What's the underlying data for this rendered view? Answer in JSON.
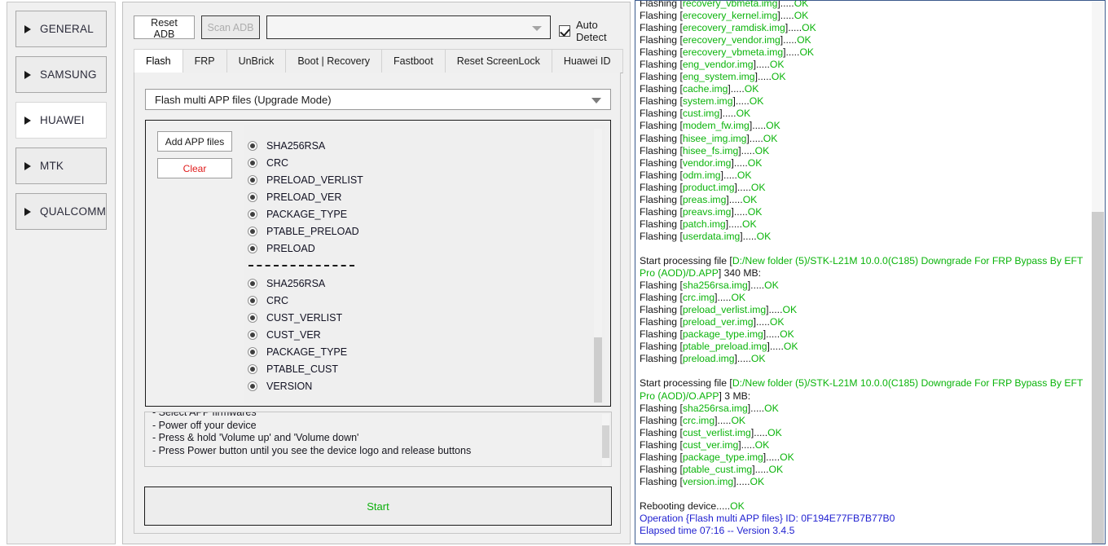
{
  "sidebar": {
    "items": [
      {
        "label": "GENERAL",
        "active": false
      },
      {
        "label": "SAMSUNG",
        "active": false
      },
      {
        "label": "HUAWEI",
        "active": true
      },
      {
        "label": "MTK",
        "active": false
      },
      {
        "label": "QUALCOMM",
        "active": false
      }
    ]
  },
  "toolbar": {
    "reset_adb_label": "Reset ADB",
    "scan_adb_label": "Scan ADB",
    "device_combo_value": "",
    "auto_detect_label": "Auto Detect",
    "auto_detect_checked": true
  },
  "tabs": [
    {
      "label": "Flash",
      "active": true
    },
    {
      "label": "FRP",
      "active": false
    },
    {
      "label": "UnBrick",
      "active": false
    },
    {
      "label": "Boot | Recovery",
      "active": false
    },
    {
      "label": "Fastboot",
      "active": false
    },
    {
      "label": "Reset ScreenLock",
      "active": false
    },
    {
      "label": "Huawei ID",
      "active": false
    }
  ],
  "flash": {
    "mode_value": "Flash multi APP files (Upgrade Mode)",
    "add_app_label": "Add APP files",
    "clear_label": "Clear",
    "start_label": "Start",
    "partitions": [
      "SHA256RSA",
      "CRC",
      "PRELOAD_VERLIST",
      "PRELOAD_VER",
      "PACKAGE_TYPE",
      "PTABLE_PRELOAD",
      "PRELOAD",
      "---SEPARATOR---",
      "SHA256RSA",
      "CRC",
      "CUST_VERLIST",
      "CUST_VER",
      "PACKAGE_TYPE",
      "PTABLE_CUST",
      "VERSION"
    ],
    "instructions": [
      "- Select APP firmwares",
      "- Power off your device",
      "- Press & hold 'Volume up' and 'Volume down'",
      "- Press Power button until you see the device logo and release buttons"
    ]
  },
  "log": {
    "lines": [
      {
        "segments": [
          {
            "t": "Flashing [",
            "c": "k"
          },
          {
            "t": "recovery_vbmeta.img",
            "c": "g"
          },
          {
            "t": "].....",
            "c": "k"
          },
          {
            "t": "OK",
            "c": "g"
          }
        ]
      },
      {
        "segments": [
          {
            "t": "Flashing [",
            "c": "k"
          },
          {
            "t": "erecovery_kernel.img",
            "c": "g"
          },
          {
            "t": "].....",
            "c": "k"
          },
          {
            "t": "OK",
            "c": "g"
          }
        ]
      },
      {
        "segments": [
          {
            "t": "Flashing [",
            "c": "k"
          },
          {
            "t": "erecovery_ramdisk.img",
            "c": "g"
          },
          {
            "t": "].....",
            "c": "k"
          },
          {
            "t": "OK",
            "c": "g"
          }
        ]
      },
      {
        "segments": [
          {
            "t": "Flashing [",
            "c": "k"
          },
          {
            "t": "erecovery_vendor.img",
            "c": "g"
          },
          {
            "t": "].....",
            "c": "k"
          },
          {
            "t": "OK",
            "c": "g"
          }
        ]
      },
      {
        "segments": [
          {
            "t": "Flashing [",
            "c": "k"
          },
          {
            "t": "erecovery_vbmeta.img",
            "c": "g"
          },
          {
            "t": "].....",
            "c": "k"
          },
          {
            "t": "OK",
            "c": "g"
          }
        ]
      },
      {
        "segments": [
          {
            "t": "Flashing [",
            "c": "k"
          },
          {
            "t": "eng_vendor.img",
            "c": "g"
          },
          {
            "t": "].....",
            "c": "k"
          },
          {
            "t": "OK",
            "c": "g"
          }
        ]
      },
      {
        "segments": [
          {
            "t": "Flashing [",
            "c": "k"
          },
          {
            "t": "eng_system.img",
            "c": "g"
          },
          {
            "t": "].....",
            "c": "k"
          },
          {
            "t": "OK",
            "c": "g"
          }
        ]
      },
      {
        "segments": [
          {
            "t": "Flashing [",
            "c": "k"
          },
          {
            "t": "cache.img",
            "c": "g"
          },
          {
            "t": "].....",
            "c": "k"
          },
          {
            "t": "OK",
            "c": "g"
          }
        ]
      },
      {
        "segments": [
          {
            "t": "Flashing [",
            "c": "k"
          },
          {
            "t": "system.img",
            "c": "g"
          },
          {
            "t": "].....",
            "c": "k"
          },
          {
            "t": "OK",
            "c": "g"
          }
        ]
      },
      {
        "segments": [
          {
            "t": "Flashing [",
            "c": "k"
          },
          {
            "t": "cust.img",
            "c": "g"
          },
          {
            "t": "].....",
            "c": "k"
          },
          {
            "t": "OK",
            "c": "g"
          }
        ]
      },
      {
        "segments": [
          {
            "t": "Flashing [",
            "c": "k"
          },
          {
            "t": "modem_fw.img",
            "c": "g"
          },
          {
            "t": "].....",
            "c": "k"
          },
          {
            "t": "OK",
            "c": "g"
          }
        ]
      },
      {
        "segments": [
          {
            "t": "Flashing [",
            "c": "k"
          },
          {
            "t": "hisee_img.img",
            "c": "g"
          },
          {
            "t": "].....",
            "c": "k"
          },
          {
            "t": "OK",
            "c": "g"
          }
        ]
      },
      {
        "segments": [
          {
            "t": "Flashing [",
            "c": "k"
          },
          {
            "t": "hisee_fs.img",
            "c": "g"
          },
          {
            "t": "].....",
            "c": "k"
          },
          {
            "t": "OK",
            "c": "g"
          }
        ]
      },
      {
        "segments": [
          {
            "t": "Flashing [",
            "c": "k"
          },
          {
            "t": "vendor.img",
            "c": "g"
          },
          {
            "t": "].....",
            "c": "k"
          },
          {
            "t": "OK",
            "c": "g"
          }
        ]
      },
      {
        "segments": [
          {
            "t": "Flashing [",
            "c": "k"
          },
          {
            "t": "odm.img",
            "c": "g"
          },
          {
            "t": "].....",
            "c": "k"
          },
          {
            "t": "OK",
            "c": "g"
          }
        ]
      },
      {
        "segments": [
          {
            "t": "Flashing [",
            "c": "k"
          },
          {
            "t": "product.img",
            "c": "g"
          },
          {
            "t": "].....",
            "c": "k"
          },
          {
            "t": "OK",
            "c": "g"
          }
        ]
      },
      {
        "segments": [
          {
            "t": "Flashing [",
            "c": "k"
          },
          {
            "t": "preas.img",
            "c": "g"
          },
          {
            "t": "].....",
            "c": "k"
          },
          {
            "t": "OK",
            "c": "g"
          }
        ]
      },
      {
        "segments": [
          {
            "t": "Flashing [",
            "c": "k"
          },
          {
            "t": "preavs.img",
            "c": "g"
          },
          {
            "t": "].....",
            "c": "k"
          },
          {
            "t": "OK",
            "c": "g"
          }
        ]
      },
      {
        "segments": [
          {
            "t": "Flashing [",
            "c": "k"
          },
          {
            "t": "patch.img",
            "c": "g"
          },
          {
            "t": "].....",
            "c": "k"
          },
          {
            "t": "OK",
            "c": "g"
          }
        ]
      },
      {
        "segments": [
          {
            "t": "Flashing [",
            "c": "k"
          },
          {
            "t": "userdata.img",
            "c": "g"
          },
          {
            "t": "].....",
            "c": "k"
          },
          {
            "t": "OK",
            "c": "g"
          }
        ]
      },
      {
        "segments": [
          {
            "t": "",
            "c": "k"
          }
        ]
      },
      {
        "segments": [
          {
            "t": "Start processing file [",
            "c": "k"
          },
          {
            "t": "D:/New folder (5)/STK-L21M 10.0.0(C185) Downgrade For FRP Bypass By EFT Pro (AOD)/D.APP",
            "c": "g"
          },
          {
            "t": "] 340 MB:",
            "c": "k"
          }
        ]
      },
      {
        "segments": [
          {
            "t": "Flashing [",
            "c": "k"
          },
          {
            "t": "sha256rsa.img",
            "c": "g"
          },
          {
            "t": "].....",
            "c": "k"
          },
          {
            "t": "OK",
            "c": "g"
          }
        ]
      },
      {
        "segments": [
          {
            "t": "Flashing [",
            "c": "k"
          },
          {
            "t": "crc.img",
            "c": "g"
          },
          {
            "t": "].....",
            "c": "k"
          },
          {
            "t": "OK",
            "c": "g"
          }
        ]
      },
      {
        "segments": [
          {
            "t": "Flashing [",
            "c": "k"
          },
          {
            "t": "preload_verlist.img",
            "c": "g"
          },
          {
            "t": "].....",
            "c": "k"
          },
          {
            "t": "OK",
            "c": "g"
          }
        ]
      },
      {
        "segments": [
          {
            "t": "Flashing [",
            "c": "k"
          },
          {
            "t": "preload_ver.img",
            "c": "g"
          },
          {
            "t": "].....",
            "c": "k"
          },
          {
            "t": "OK",
            "c": "g"
          }
        ]
      },
      {
        "segments": [
          {
            "t": "Flashing [",
            "c": "k"
          },
          {
            "t": "package_type.img",
            "c": "g"
          },
          {
            "t": "].....",
            "c": "k"
          },
          {
            "t": "OK",
            "c": "g"
          }
        ]
      },
      {
        "segments": [
          {
            "t": "Flashing [",
            "c": "k"
          },
          {
            "t": "ptable_preload.img",
            "c": "g"
          },
          {
            "t": "].....",
            "c": "k"
          },
          {
            "t": "OK",
            "c": "g"
          }
        ]
      },
      {
        "segments": [
          {
            "t": "Flashing [",
            "c": "k"
          },
          {
            "t": "preload.img",
            "c": "g"
          },
          {
            "t": "].....",
            "c": "k"
          },
          {
            "t": "OK",
            "c": "g"
          }
        ]
      },
      {
        "segments": [
          {
            "t": "",
            "c": "k"
          }
        ]
      },
      {
        "segments": [
          {
            "t": "Start processing file [",
            "c": "k"
          },
          {
            "t": "D:/New folder (5)/STK-L21M 10.0.0(C185) Downgrade For FRP Bypass By EFT Pro (AOD)/O.APP",
            "c": "g"
          },
          {
            "t": "] 3 MB:",
            "c": "k"
          }
        ]
      },
      {
        "segments": [
          {
            "t": "Flashing [",
            "c": "k"
          },
          {
            "t": "sha256rsa.img",
            "c": "g"
          },
          {
            "t": "].....",
            "c": "k"
          },
          {
            "t": "OK",
            "c": "g"
          }
        ]
      },
      {
        "segments": [
          {
            "t": "Flashing [",
            "c": "k"
          },
          {
            "t": "crc.img",
            "c": "g"
          },
          {
            "t": "].....",
            "c": "k"
          },
          {
            "t": "OK",
            "c": "g"
          }
        ]
      },
      {
        "segments": [
          {
            "t": "Flashing [",
            "c": "k"
          },
          {
            "t": "cust_verlist.img",
            "c": "g"
          },
          {
            "t": "].....",
            "c": "k"
          },
          {
            "t": "OK",
            "c": "g"
          }
        ]
      },
      {
        "segments": [
          {
            "t": "Flashing [",
            "c": "k"
          },
          {
            "t": "cust_ver.img",
            "c": "g"
          },
          {
            "t": "].....",
            "c": "k"
          },
          {
            "t": "OK",
            "c": "g"
          }
        ]
      },
      {
        "segments": [
          {
            "t": "Flashing [",
            "c": "k"
          },
          {
            "t": "package_type.img",
            "c": "g"
          },
          {
            "t": "].....",
            "c": "k"
          },
          {
            "t": "OK",
            "c": "g"
          }
        ]
      },
      {
        "segments": [
          {
            "t": "Flashing [",
            "c": "k"
          },
          {
            "t": "ptable_cust.img",
            "c": "g"
          },
          {
            "t": "].....",
            "c": "k"
          },
          {
            "t": "OK",
            "c": "g"
          }
        ]
      },
      {
        "segments": [
          {
            "t": "Flashing [",
            "c": "k"
          },
          {
            "t": "version.img",
            "c": "g"
          },
          {
            "t": "].....",
            "c": "k"
          },
          {
            "t": "OK",
            "c": "g"
          }
        ]
      },
      {
        "segments": [
          {
            "t": "",
            "c": "k"
          }
        ]
      },
      {
        "segments": [
          {
            "t": "Rebooting device.....",
            "c": "k"
          },
          {
            "t": "OK",
            "c": "g"
          }
        ]
      },
      {
        "segments": [
          {
            "t": "Operation {Flash multi APP files} ID: 0F194E77FB7B77B0",
            "c": "b"
          }
        ]
      },
      {
        "segments": [
          {
            "t": "Elapsed time 07:16 -- Version 3.4.5",
            "c": "b"
          }
        ]
      }
    ]
  }
}
